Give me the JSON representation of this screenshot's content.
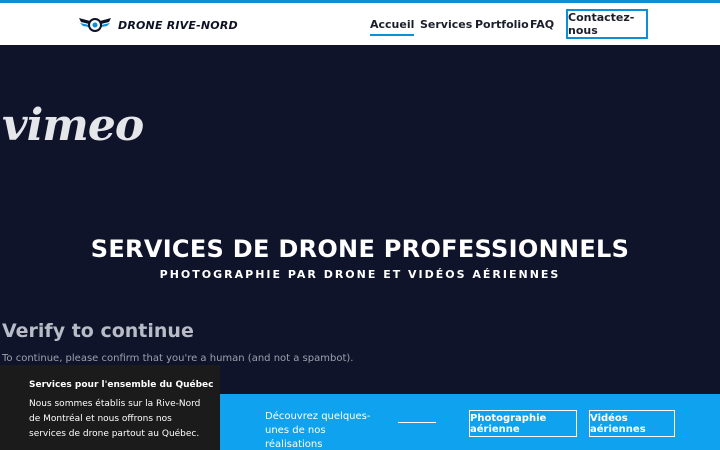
{
  "header": {
    "brand": "DRONE RIVE-NORD",
    "logo_icon": "drone-wings-icon",
    "accent_color": "#0b8fd6",
    "nav": [
      {
        "label": "Accueil",
        "active": true
      },
      {
        "label": "Services",
        "active": false
      },
      {
        "label": "Portfolio",
        "active": false
      },
      {
        "label": "FAQ",
        "active": false
      }
    ],
    "contact_label": "Contactez-nous"
  },
  "hero": {
    "video_brand": "vimeo",
    "title": "SERVICES DE DRONE PROFESSIONNELS",
    "subtitle": "PHOTOGRAPHIE PAR DRONE ET VIDÉOS AÉRIENNES",
    "background_color": "#10142a"
  },
  "verify": {
    "title": "Verify to continue",
    "text": "To continue, please confirm that you're a human (and not a spambot)."
  },
  "cta_strip": {
    "text": "Découvrez quelques-unes de nos réalisations",
    "buttons": [
      "Photographie aérienne",
      "Vidéos aériennes"
    ],
    "background_color": "#0ea2ef"
  },
  "notice": {
    "title": "Services pour l'ensemble du Québec",
    "body": "Nous sommes établis sur la Rive-Nord de Montréal et nous offrons nos services de drone partout au Québec."
  }
}
